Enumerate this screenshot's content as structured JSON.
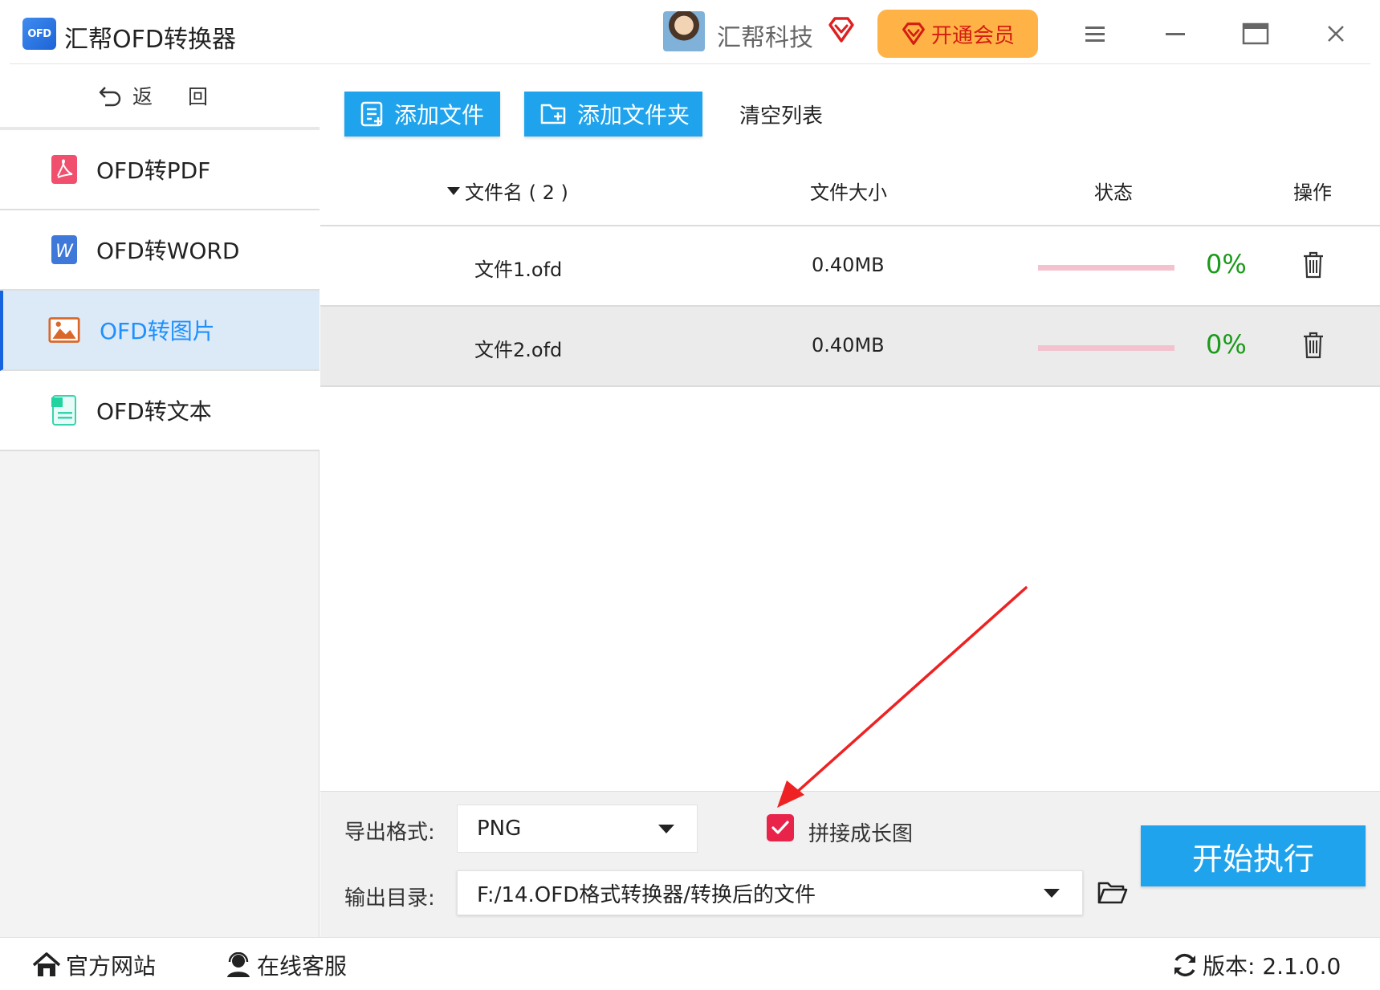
{
  "app": {
    "logo_text": "OFD",
    "title": "汇帮OFD转换器",
    "user_name": "汇帮科技",
    "vip_label": "开通会员"
  },
  "sidebar": {
    "back_label": "返 回",
    "items": [
      {
        "label": "OFD转PDF",
        "icon": "pdf-icon",
        "active": false
      },
      {
        "label": "OFD转WORD",
        "icon": "word-icon",
        "active": false
      },
      {
        "label": "OFD转图片",
        "icon": "image-icon",
        "active": true
      },
      {
        "label": "OFD转文本",
        "icon": "text-icon",
        "active": false
      }
    ]
  },
  "toolbar": {
    "add_file_label": "添加文件",
    "add_folder_label": "添加文件夹",
    "clear_label": "清空列表"
  },
  "table": {
    "headers": {
      "name": "文件名 ( 2 )",
      "size": "文件大小",
      "status": "状态",
      "action": "操作"
    },
    "rows": [
      {
        "name": "文件1.ofd",
        "size": "0.40MB",
        "progress": 0,
        "percent": "0%"
      },
      {
        "name": "文件2.ofd",
        "size": "0.40MB",
        "progress": 0,
        "percent": "0%"
      }
    ]
  },
  "settings": {
    "format_label": "导出格式:",
    "format_value": "PNG",
    "merge_label": "拼接成长图",
    "merge_checked": true,
    "output_label": "输出目录:",
    "output_value": "F:/14.OFD格式转换器/转换后的文件",
    "start_label": "开始执行"
  },
  "footer": {
    "website_label": "官方网站",
    "service_label": "在线客服",
    "version_label": "版本:  2.1.0.0"
  },
  "colors": {
    "accent": "#1fa3ec",
    "active_text": "#1e90ff",
    "vip": "#ffb347",
    "progress_track": "#f2c2cf",
    "percent": "#1a9a1a",
    "checkbox": "#e8244a",
    "annotation_arrow": "#ee2222"
  }
}
